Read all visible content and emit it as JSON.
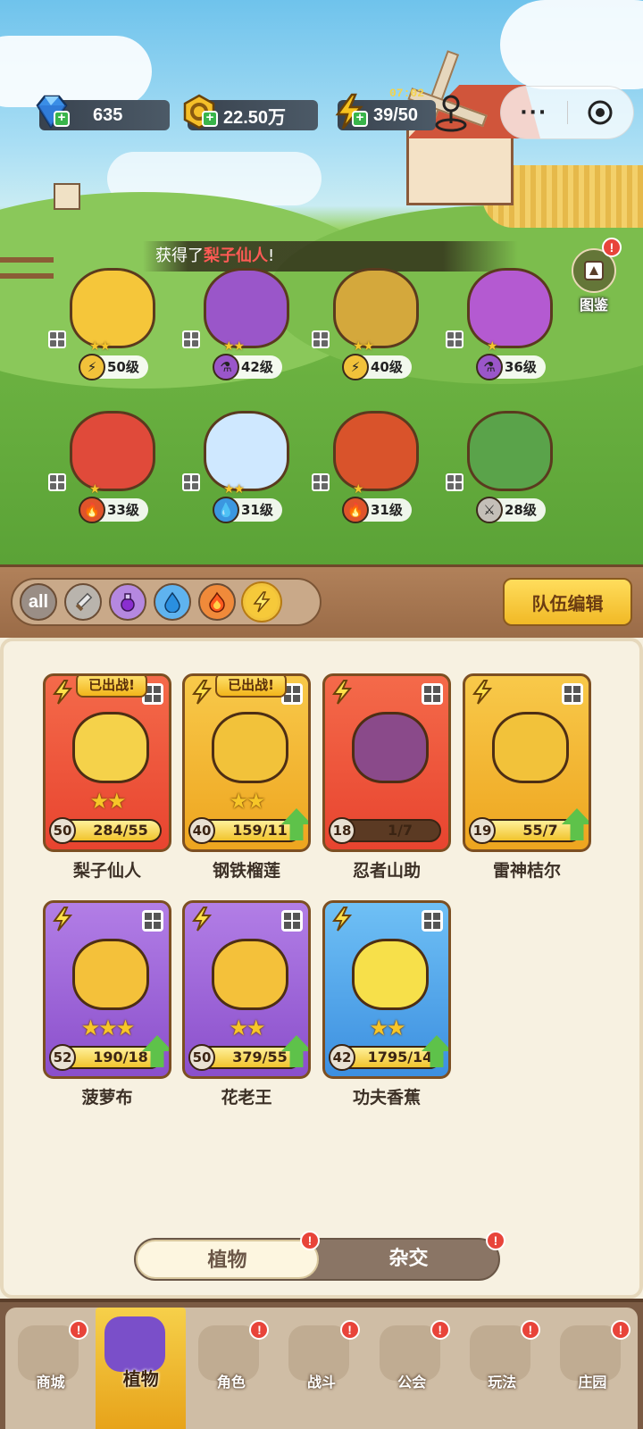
{
  "status": {
    "gems": "635",
    "gold": "22.50万",
    "energy": "39/50",
    "energy_timer": "07:02"
  },
  "capsule": {
    "more": "···"
  },
  "toast": {
    "prefix": "获得了",
    "highlight": "梨子仙人",
    "suffix": "!"
  },
  "atlas": {
    "label": "图鉴",
    "badge": "!"
  },
  "field_units": [
    {
      "level": "50级",
      "element": "lightning-icon",
      "stars": 2,
      "color": "#f5c63a"
    },
    {
      "level": "42级",
      "element": "potion-icon",
      "stars": 2,
      "color": "#9a56c9"
    },
    {
      "level": "40级",
      "element": "lightning-icon",
      "stars": 2,
      "color": "#d4a83c"
    },
    {
      "level": "36级",
      "element": "potion-icon",
      "stars": 1,
      "color": "#b45ad1"
    },
    {
      "level": "33级",
      "element": "fire-icon",
      "stars": 1,
      "color": "#e04a3a"
    },
    {
      "level": "31级",
      "element": "water-icon",
      "stars": 2,
      "color": "#cfe8ff"
    },
    {
      "level": "31级",
      "element": "fire-icon",
      "stars": 1,
      "color": "#d9532b"
    },
    {
      "level": "28级",
      "element": "sword-icon",
      "stars": 0,
      "color": "#5aa34a"
    }
  ],
  "filters": [
    {
      "name": "all",
      "label": "all"
    },
    {
      "name": "sword",
      "label": ""
    },
    {
      "name": "potion",
      "label": ""
    },
    {
      "name": "water",
      "label": ""
    },
    {
      "name": "fire",
      "label": ""
    },
    {
      "name": "lightning",
      "label": ""
    }
  ],
  "team_edit": "队伍编辑",
  "deployed_label": "已出战!",
  "cards": [
    {
      "name": "梨子仙人",
      "level": "50",
      "progress": "284/55",
      "stars": 2,
      "rarity": "orange",
      "deployed": true,
      "upgrade": false,
      "fill": 1.0
    },
    {
      "name": "钢铁榴莲",
      "level": "40",
      "progress": "159/11",
      "stars": 2,
      "rarity": "gold",
      "deployed": true,
      "upgrade": true,
      "fill": 1.0
    },
    {
      "name": "忍者山助",
      "level": "18",
      "progress": "1/7",
      "stars": 0,
      "rarity": "orange",
      "deployed": false,
      "upgrade": false,
      "fill": 0.14
    },
    {
      "name": "雷神桔尔",
      "level": "19",
      "progress": "55/7",
      "stars": 0,
      "rarity": "gold",
      "deployed": false,
      "upgrade": true,
      "fill": 1.0
    },
    {
      "name": "菠萝布",
      "level": "52",
      "progress": "190/18",
      "stars": 3,
      "rarity": "purple",
      "deployed": false,
      "upgrade": true,
      "fill": 1.0
    },
    {
      "name": "花老王",
      "level": "50",
      "progress": "379/55",
      "stars": 2,
      "rarity": "purple",
      "deployed": false,
      "upgrade": true,
      "fill": 1.0
    },
    {
      "name": "功夫香蕉",
      "level": "42",
      "progress": "1795/14",
      "stars": 2,
      "rarity": "blue",
      "deployed": false,
      "upgrade": true,
      "fill": 1.0
    }
  ],
  "segment": {
    "plants": "植物",
    "hybrid": "杂交",
    "badge": "!"
  },
  "nav": [
    {
      "label": "商城",
      "badge": true,
      "active": false
    },
    {
      "label": "植物",
      "badge": false,
      "active": true
    },
    {
      "label": "角色",
      "badge": true,
      "active": false
    },
    {
      "label": "战斗",
      "badge": true,
      "active": false
    },
    {
      "label": "公会",
      "badge": true,
      "active": false
    },
    {
      "label": "玩法",
      "badge": true,
      "active": false
    },
    {
      "label": "庄园",
      "badge": true,
      "active": false
    }
  ],
  "colors": {
    "orange_card": "#f05a3a",
    "gold_card": "#f4b833",
    "purple_card": "#9b5fd1",
    "blue_card": "#4aa3e8",
    "toast_highlight": "#ff5a55"
  }
}
